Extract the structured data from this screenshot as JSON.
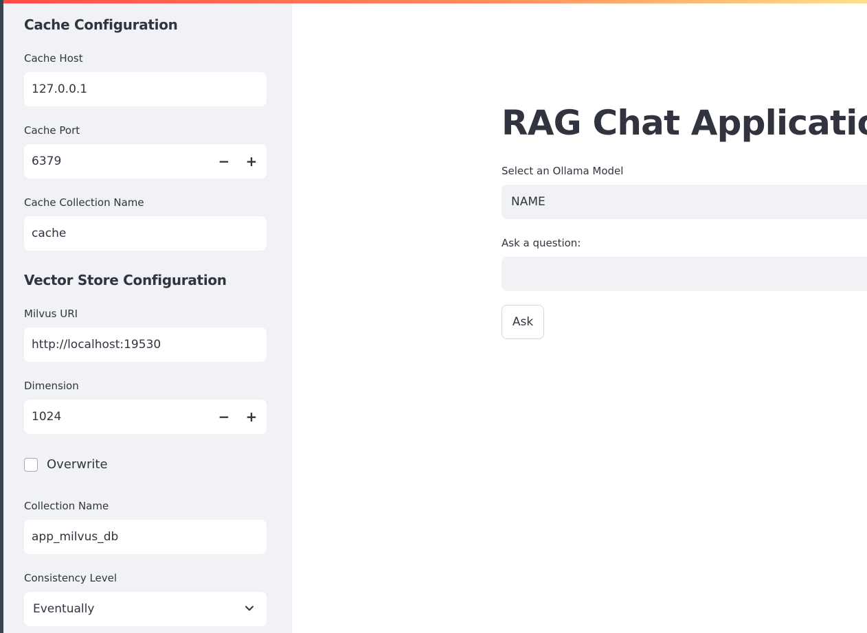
{
  "sidebar": {
    "cache_section": {
      "title": "Cache Configuration",
      "host_label": "Cache Host",
      "host_value": "127.0.0.1",
      "port_label": "Cache Port",
      "port_value": "6379",
      "collection_label": "Cache Collection Name",
      "collection_value": "cache"
    },
    "vector_section": {
      "title": "Vector Store Configuration",
      "uri_label": "Milvus URI",
      "uri_value": "http://localhost:19530",
      "dimension_label": "Dimension",
      "dimension_value": "1024",
      "overwrite_label": "Overwrite",
      "overwrite_checked": false,
      "collection_label": "Collection Name",
      "collection_value": "app_milvus_db",
      "consistency_label": "Consistency Level",
      "consistency_value": "Eventually"
    },
    "stepper": {
      "minus": "−",
      "plus": "+"
    }
  },
  "main": {
    "title": "RAG Chat Application",
    "model_label": "Select an Ollama Model",
    "model_value": "NAME",
    "question_label": "Ask a question:",
    "question_value": "",
    "ask_button": "Ask"
  },
  "colors": {
    "sidebar_bg": "#f0f2f6",
    "text": "#31333f",
    "accent_gradient_start": "#ff4b4b",
    "accent_gradient_end": "#ffe08a"
  }
}
